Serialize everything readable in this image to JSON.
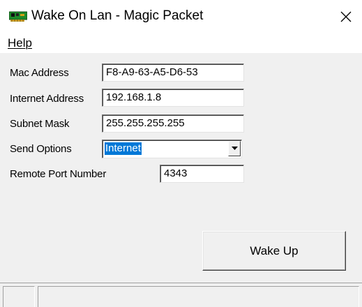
{
  "window": {
    "title": "Wake On Lan - Magic Packet",
    "app_icon": "network-card-icon",
    "close_icon": "close-icon"
  },
  "menu": {
    "help_label": "Help"
  },
  "form": {
    "mac_label": "Mac Address",
    "mac_value": "F8-A9-63-A5-D6-53",
    "internet_label": "Internet Address",
    "internet_value": "192.168.1.8",
    "subnet_label": "Subnet Mask",
    "subnet_value": "255.255.255.255",
    "send_options_label": "Send Options",
    "send_options_value": "Internet",
    "port_label": "Remote Port Number",
    "port_value": "4343"
  },
  "actions": {
    "wake_label": "Wake Up"
  },
  "colors": {
    "selection": "#0078d7",
    "window_bg": "#f0f0f0",
    "titlebar_bg": "#ffffff"
  }
}
